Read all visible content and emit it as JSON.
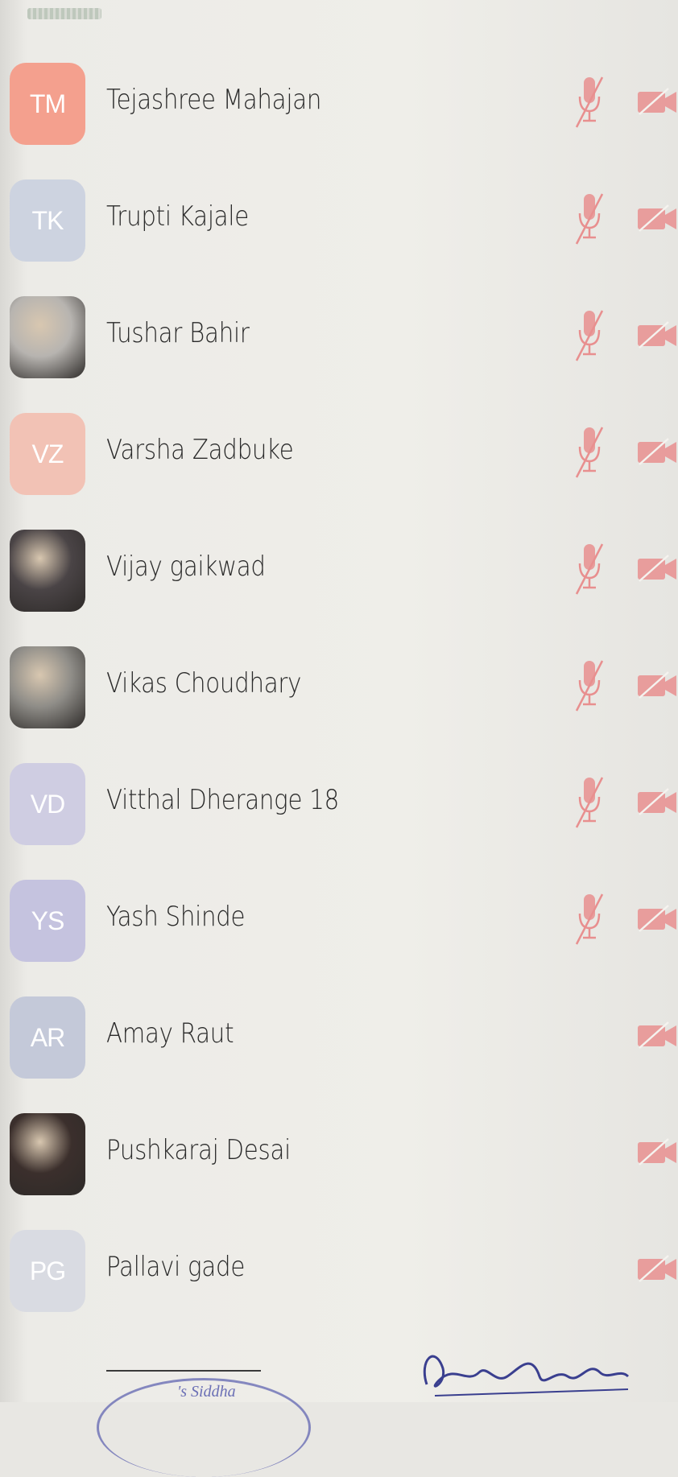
{
  "participants": [
    {
      "name": "Tejashree Mahajan",
      "initials": "TM",
      "avatar": "initials",
      "color": "#f4a08e",
      "mic_muted": true,
      "video_off": true
    },
    {
      "name": "Trupti Kajale",
      "initials": "TK",
      "avatar": "initials",
      "color": "#cdd3e0",
      "mic_muted": true,
      "video_off": true
    },
    {
      "name": "Tushar Bahir",
      "initials": "",
      "avatar": "photo",
      "color": "#b7b4b0",
      "mic_muted": true,
      "video_off": true
    },
    {
      "name": "Varsha Zadbuke",
      "initials": "VZ",
      "avatar": "initials",
      "color": "#f2c2b5",
      "mic_muted": true,
      "video_off": true
    },
    {
      "name": "Vijay gaikwad",
      "initials": "",
      "avatar": "photo",
      "color": "#4a4446",
      "mic_muted": true,
      "video_off": true
    },
    {
      "name": "Vikas Choudhary",
      "initials": "",
      "avatar": "photo",
      "color": "#8f8d88",
      "mic_muted": true,
      "video_off": true
    },
    {
      "name": "Vitthal Dherange 18",
      "initials": "VD",
      "avatar": "initials",
      "color": "#cfcde2",
      "mic_muted": true,
      "video_off": true
    },
    {
      "name": "Yash Shinde",
      "initials": "YS",
      "avatar": "initials",
      "color": "#c5c3df",
      "mic_muted": true,
      "video_off": true
    },
    {
      "name": "Amay Raut",
      "initials": "AR",
      "avatar": "initials",
      "color": "#c4c9d9",
      "mic_muted": false,
      "video_off": true
    },
    {
      "name": "Pushkaraj Desai",
      "initials": "",
      "avatar": "photo",
      "color": "#3b2f2c",
      "mic_muted": false,
      "video_off": true
    },
    {
      "name": "Pallavi gade",
      "initials": "PG",
      "avatar": "initials",
      "color": "#d9dbe2",
      "mic_muted": false,
      "video_off": true
    }
  ],
  "stamp_text": "'s Siddha",
  "icons": {
    "mic": "mic-muted-icon",
    "camera": "video-off-icon"
  },
  "colors": {
    "muted_icon": "#e88f8f",
    "name_text": "#2a2a2a"
  }
}
